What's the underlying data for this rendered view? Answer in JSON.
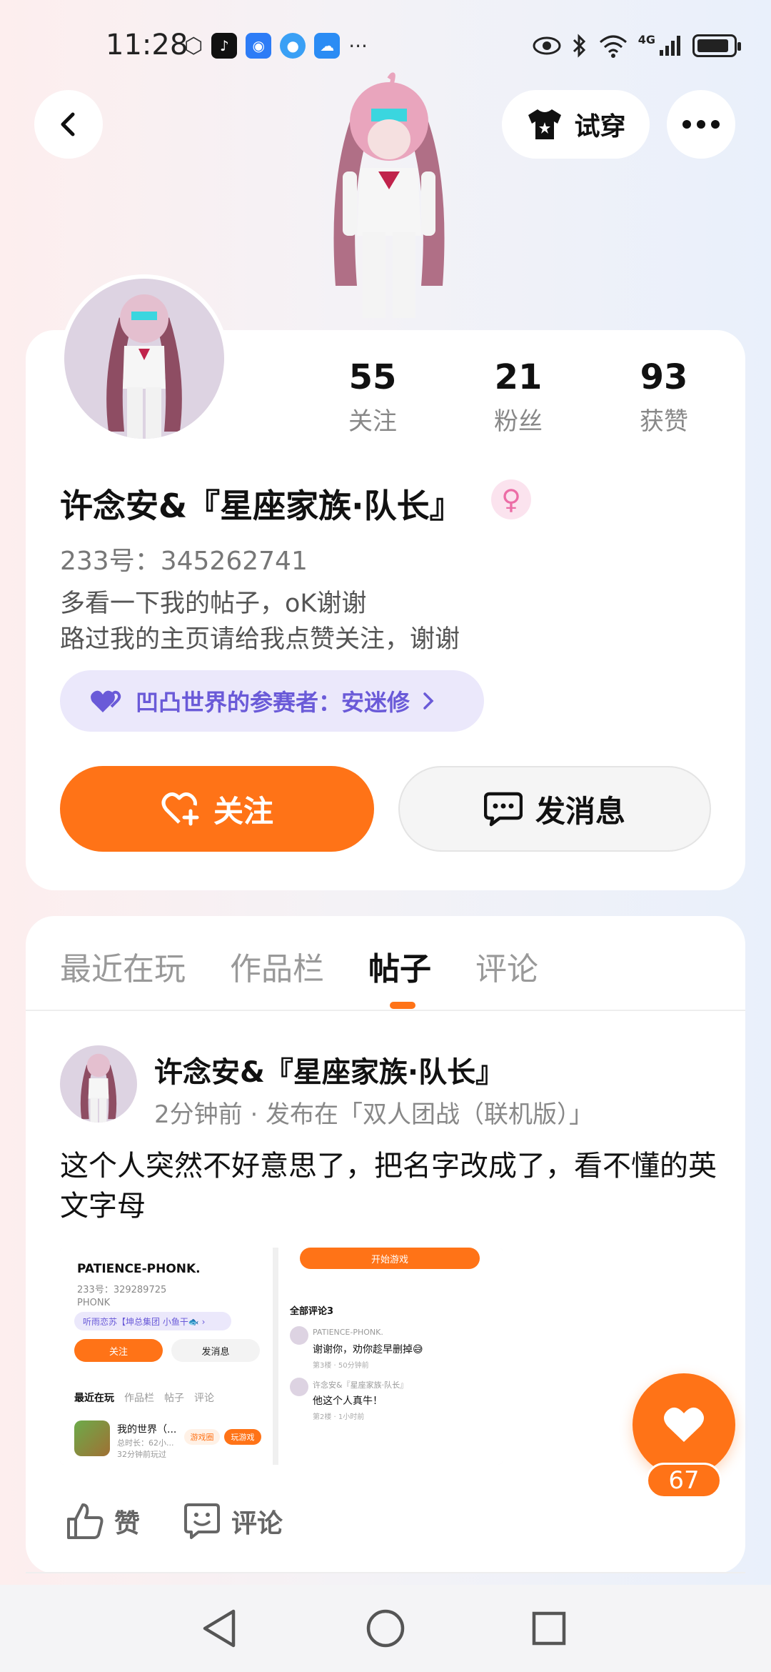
{
  "status_bar": {
    "time": "11:28",
    "network": "4G",
    "battery_level": 0.9,
    "icons": [
      "hexagon-icon",
      "tiktok-icon",
      "bulb-icon",
      "planet-icon",
      "cloud-app-icon",
      "more-dots-icon",
      "eye-icon",
      "bluetooth-icon",
      "wifi-icon",
      "signal-icon",
      "battery-icon"
    ]
  },
  "header": {
    "try_on_label": "试穿"
  },
  "profile": {
    "stats": [
      {
        "value": "55",
        "label": "关注"
      },
      {
        "value": "21",
        "label": "粉丝"
      },
      {
        "value": "93",
        "label": "获赞"
      }
    ],
    "name": "许念安&『星座家族·队长』",
    "gender_symbol": "♀",
    "uid": "233号：345262741",
    "bio_line1": "多看一下我的帖子，oK谢谢",
    "bio_line2": "路过我的主页请给我点赞关注，谢谢",
    "event_badge": "凹凸世界的参赛者：安迷修",
    "follow_label": "关注",
    "message_label": "发消息"
  },
  "tabs": [
    "最近在玩",
    "作品栏",
    "帖子",
    "评论"
  ],
  "active_tab": "帖子",
  "post": {
    "author": "许念安&『星座家族·队长』",
    "meta": "2分钟前 · 发布在「双人团战（联机版）」",
    "text": "这个人突然不好意思了，把名字改成了，看不懂的英文字母",
    "image": {
      "name": "PATIENCE-PHONK.",
      "uid": "233号：329289725",
      "sub": "PHONK",
      "badge": "听雨恋苏【坤总集团 小鱼干🐟 ›",
      "follow": "关注",
      "message": "发消息",
      "tabs": [
        "最近在玩",
        "作品栏",
        "帖子",
        "评论"
      ],
      "game_name": "我的世界（...",
      "game_meta1": "总时长：62小...",
      "game_meta2": "32分钟前玩过",
      "game_tag": "游戏圈",
      "game_play": "玩游戏",
      "start_game": "开始游戏",
      "comments_title": "全部评论3",
      "comments": [
        {
          "user": "PATIENCE-PHONK.",
          "text": "谢谢你，劝你趁早删掉😅",
          "meta": "第3楼 · 50分钟前"
        },
        {
          "user": "许念安&『星座家族·队长』",
          "text": "他这个人真牛！",
          "meta": "第2楼 · 1小时前"
        }
      ]
    },
    "like_label": "赞",
    "comment_label": "评论",
    "float_like_count": "67"
  },
  "colors": {
    "accent": "#ff7317",
    "badge_bg": "#ebe8fb",
    "badge_text": "#6a5ad8",
    "gender": "#ec6da6"
  }
}
